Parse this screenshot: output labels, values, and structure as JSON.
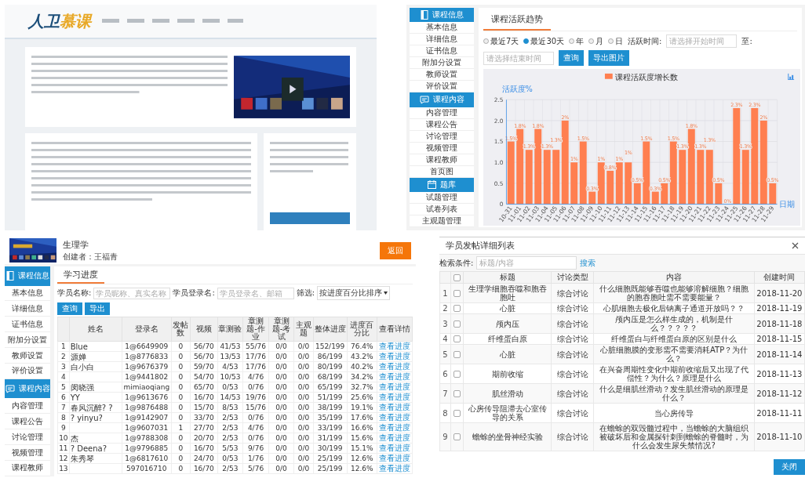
{
  "course_home": {
    "logo": [
      "人卫",
      "慕课"
    ]
  },
  "activity_trend": {
    "sidebar": [
      {
        "label": "课程信息",
        "kind": "header"
      },
      {
        "label": "基本信息",
        "kind": "item"
      },
      {
        "label": "详细信息",
        "kind": "item"
      },
      {
        "label": "证书信息",
        "kind": "item"
      },
      {
        "label": "附加分设置",
        "kind": "item"
      },
      {
        "label": "教师设置",
        "kind": "item"
      },
      {
        "label": "评价设置",
        "kind": "item"
      },
      {
        "label": "课程内容",
        "kind": "header"
      },
      {
        "label": "内容管理",
        "kind": "item"
      },
      {
        "label": "课程公告",
        "kind": "item"
      },
      {
        "label": "讨论管理",
        "kind": "item"
      },
      {
        "label": "视频管理",
        "kind": "item"
      },
      {
        "label": "课程教师",
        "kind": "item"
      },
      {
        "label": "首页图",
        "kind": "item"
      },
      {
        "label": "题库",
        "kind": "header"
      },
      {
        "label": "试题管理",
        "kind": "item"
      },
      {
        "label": "试卷列表",
        "kind": "item"
      },
      {
        "label": "主观题管理",
        "kind": "item"
      }
    ],
    "tab": "课程活跃趋势",
    "ranges": [
      {
        "label": "最近7天",
        "selected": false
      },
      {
        "label": "最近30天",
        "selected": true
      }
    ],
    "periods": [
      {
        "label": "年",
        "selected": false
      },
      {
        "label": "月",
        "selected": false
      },
      {
        "label": "日",
        "selected": false
      }
    ],
    "time_label": "活跃时间:",
    "start": {
      "placeholder": "请选择开始时间"
    },
    "to_label": "至:",
    "end": {
      "placeholder": "请选择结束时间"
    },
    "buttons": [
      "查询",
      "导出图片"
    ],
    "chart_data": {
      "type": "bar",
      "grid": true,
      "ylabel": "活跃度%",
      "xlabel": "日期",
      "ylim": [
        0,
        2.5
      ],
      "yticks": [
        {
          "value": 0,
          "label": "0"
        },
        {
          "value": 0.5,
          "label": "0.5"
        },
        {
          "value": 1,
          "label": "1.0"
        },
        {
          "value": 1.5,
          "label": "1.5"
        },
        {
          "value": 2,
          "label": "2.0"
        },
        {
          "value": 2.5,
          "label": "2.5"
        }
      ],
      "categories": [
        "10-31",
        "11-01",
        "11-02",
        "11-03",
        "11-04",
        "11-05",
        "11-06",
        "11-07",
        "11-08",
        "11-09",
        "11-10",
        "11-11",
        "11-12",
        "11-13",
        "11-14",
        "11-15",
        "11-16",
        "11-17",
        "11-18",
        "11-19",
        "11-20",
        "11-21",
        "11-22",
        "11-23",
        "11-24",
        "11-25",
        "11-26",
        "11-27",
        "11-28",
        "11-29"
      ],
      "series": [
        {
          "name": "课程活跃度增长数",
          "color": "#ff7f50",
          "values": [
            1.5,
            1.8,
            1.3,
            1.8,
            1.3,
            1.3,
            2,
            1,
            1.5,
            0.3,
            1,
            0.8,
            1,
            1,
            0.5,
            1.5,
            0.3,
            0.5,
            1.5,
            1.3,
            1.8,
            1.3,
            1.3,
            0.5,
            0,
            2.3,
            1.3,
            2.3,
            2,
            0.5
          ]
        }
      ],
      "value_labels": [
        "1.5%",
        "1.8%",
        "1.3%",
        "1.8%",
        "1.3%",
        "1.3%",
        "2%",
        "1%",
        "1.5%",
        "0.3%",
        "1%",
        "0.8%",
        "1%",
        "1%",
        "0.5%",
        "1.5%",
        "0.3%",
        "0.5%",
        "1.5%",
        "1.3%",
        "1.8%",
        "1.3%",
        "1.3%",
        "0.5%",
        "0%",
        "2.3%",
        "1.3%",
        "2.3%",
        "2%",
        "0.5%"
      ]
    }
  },
  "study_progress": {
    "course": {
      "title": "生理学",
      "creator": "创建者：王福青",
      "back_button": "返回"
    },
    "sidebar": [
      {
        "label": "课程信息",
        "kind": "header"
      },
      {
        "label": "基本信息",
        "kind": "item"
      },
      {
        "label": "详细信息",
        "kind": "item"
      },
      {
        "label": "证书信息",
        "kind": "item"
      },
      {
        "label": "附加分设置",
        "kind": "item"
      },
      {
        "label": "教师设置",
        "kind": "item"
      },
      {
        "label": "评价设置",
        "kind": "item"
      },
      {
        "label": "课程内容",
        "kind": "header"
      },
      {
        "label": "内容管理",
        "kind": "item"
      },
      {
        "label": "课程公告",
        "kind": "item"
      },
      {
        "label": "讨论管理",
        "kind": "item"
      },
      {
        "label": "视频管理",
        "kind": "item"
      },
      {
        "label": "课程教师",
        "kind": "item"
      }
    ],
    "tab": "学习进度",
    "filters": [
      {
        "label": "学员名称:",
        "kind": "input",
        "placeholder": "学员昵称、真实名称"
      },
      {
        "label": "学员登录名:",
        "kind": "input",
        "placeholder": "学员登录名、邮箱"
      },
      {
        "label": "筛选:",
        "kind": "select",
        "value": "按进度百分比排序"
      }
    ],
    "buttons": [
      "查询",
      "导出"
    ],
    "table": {
      "columns": [
        "",
        "姓名",
        "登录名",
        "发帖数",
        "视频",
        "章测验",
        "章测题-作业",
        "章测题-考试",
        "主观题",
        "整体进度",
        "进度百分比",
        "查看详情"
      ],
      "rows": [
        [
          "1",
          "Blue",
          "1@6649909",
          "0",
          "56/70",
          "41/53",
          "55/76",
          "0/0",
          "0/0",
          "152/199",
          "76.4%",
          "查看进度"
        ],
        [
          "2",
          "源婵",
          "1@8776833",
          "0",
          "56/70",
          "13/53",
          "17/76",
          "0/0",
          "0/0",
          "86/199",
          "43.2%",
          "查看进度"
        ],
        [
          "3",
          "白小白",
          "1@9676379",
          "0",
          "59/70",
          "4/53",
          "17/76",
          "0/0",
          "0/0",
          "80/199",
          "40.2%",
          "查看进度"
        ],
        [
          "4",
          "",
          "1@9441802",
          "0",
          "54/70",
          "10/53",
          "4/76",
          "0/0",
          "0/0",
          "68/199",
          "34.2%",
          "查看进度"
        ],
        [
          "5",
          "闵晓强",
          "mimiaoqiang",
          "0",
          "65/70",
          "0/53",
          "0/76",
          "0/0",
          "0/0",
          "65/199",
          "32.7%",
          "查看进度"
        ],
        [
          "6",
          "YY",
          "1@9613676",
          "0",
          "16/70",
          "14/53",
          "19/76",
          "0/0",
          "0/0",
          "51/199",
          "25.6%",
          "查看进度"
        ],
        [
          "7",
          "春风沉醉? ?",
          "1@9876488",
          "0",
          "15/70",
          "8/53",
          "15/76",
          "0/0",
          "0/0",
          "38/199",
          "19.1%",
          "查看进度"
        ],
        [
          "8",
          "? yinyu?",
          "1@9142907",
          "0",
          "33/70",
          "2/53",
          "0/76",
          "0/0",
          "0/0",
          "35/199",
          "17.6%",
          "查看进度"
        ],
        [
          "9",
          "",
          "1@9607031",
          "1",
          "27/70",
          "2/53",
          "4/76",
          "0/0",
          "0/0",
          "33/199",
          "16.6%",
          "查看进度"
        ],
        [
          "10",
          "杰",
          "1@9788308",
          "0",
          "20/70",
          "2/53",
          "0/76",
          "0/0",
          "0/0",
          "31/199",
          "15.6%",
          "查看进度"
        ],
        [
          "11",
          "? Deena?",
          "1@9796885",
          "0",
          "16/70",
          "5/53",
          "9/76",
          "0/0",
          "0/0",
          "30/199",
          "15.1%",
          "查看进度"
        ],
        [
          "12",
          "朱秀琴",
          "1@6817610",
          "0",
          "24/70",
          "0/53",
          "1/76",
          "0/0",
          "0/0",
          "25/199",
          "12.6%",
          "查看进度"
        ],
        [
          "13",
          "",
          "597016710",
          "0",
          "16/70",
          "2/53",
          "5/76",
          "0/0",
          "0/0",
          "25/199",
          "12.6%",
          "查看进度"
        ]
      ]
    }
  },
  "post_dialog": {
    "title": "学员发帖详细列表",
    "search_label": "检索条件:",
    "search": {
      "placeholder": "标题/内容"
    },
    "search_link": "搜索",
    "table": {
      "select_all": {
        "checked": false
      },
      "columns": [
        "标题",
        "讨论类型",
        "内容",
        "创建时间"
      ],
      "rows": [
        {
          "index": "1",
          "checked": false,
          "title": "生理学细胞吞噬和胞吞胞吐",
          "type": "综合讨论",
          "content": "什么细胞既能够吞噬也能够溶解细胞？细胞的胞吞胞吐需不需要能量？",
          "created": "2018-11-20"
        },
        {
          "index": "2",
          "checked": false,
          "title": "心脏",
          "type": "综合讨论",
          "content": "心肌细胞去极化后钠离子通道开放吗？？",
          "created": "2018-11-19"
        },
        {
          "index": "3",
          "checked": false,
          "title": "颅内压",
          "type": "综合讨论",
          "content": "颅内压是怎么样生成的，机制是什么？？？？？",
          "created": "2018-11-18"
        },
        {
          "index": "4",
          "checked": false,
          "title": "纤维蛋白原",
          "type": "综合讨论",
          "content": "纤维蛋白与纤维蛋白原的区别是什么",
          "created": "2018-11-15"
        },
        {
          "index": "5",
          "checked": false,
          "title": "心脏",
          "type": "综合讨论",
          "content": "心脏细胞膜的变形需不需要消耗ATP？为什么？",
          "created": "2018-11-14"
        },
        {
          "index": "6",
          "checked": false,
          "title": "期前收缩",
          "type": "综合讨论",
          "content": "在兴奋周期性变化中期前收缩后又出现了代偿性？为什么？原理是什么",
          "created": "2018-11-13"
        },
        {
          "index": "7",
          "checked": false,
          "title": "肌丝滑动",
          "type": "综合讨论",
          "content": "什么是细肌丝滑动？发生肌丝滑动的原理是什么？",
          "created": "2018-11-12"
        },
        {
          "index": "8",
          "checked": false,
          "title": "心房传导阻滞去心室传导的关系",
          "type": "综合讨论",
          "content": "当心房传导",
          "created": "2018-11-11"
        },
        {
          "index": "9",
          "checked": false,
          "title": "蟾蜍的坐骨神经实验",
          "type": "综合讨论",
          "content": "在蟾蜍的双毁髓过程中，当蟾蜍的大脑组织被破坏后和金属探针刺到蟾蜍的脊髓时，为什么会发生尿失禁情况?",
          "created": "2018-11-10"
        }
      ]
    },
    "close_button": "关闭"
  }
}
